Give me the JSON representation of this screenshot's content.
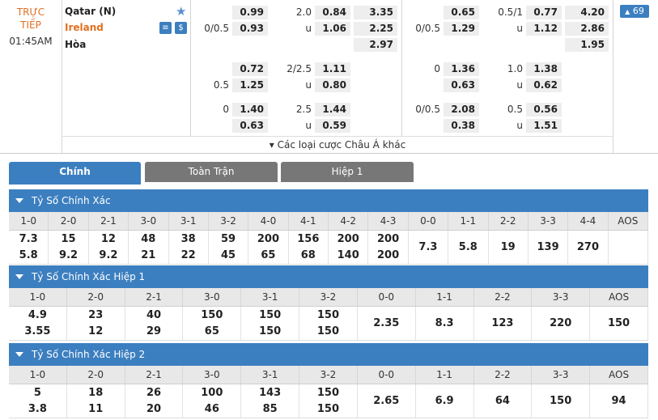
{
  "match": {
    "status": "TRỰC\nTIẾP",
    "status_l1": "TRỰC",
    "status_l2": "TIẾP",
    "time": "01:45AM",
    "home": "Qatar (N)",
    "away": "Ireland",
    "draw": "Hòa",
    "more_count": "69"
  },
  "odds_left": [
    {
      "h": "",
      "ho": "0.99",
      "ou": "2.0",
      "o1": "0.84",
      "x": "3.35"
    },
    {
      "h": "0/0.5",
      "ho": "0.93",
      "ou": "u",
      "o1": "1.06",
      "x": "2.25"
    },
    {
      "h": "",
      "ho": "",
      "ou": "",
      "o1": "",
      "x": "2.97"
    },
    {
      "h": "",
      "ho": "0.72",
      "ou": "2/2.5",
      "o1": "1.11",
      "x": ""
    },
    {
      "h": "0.5",
      "ho": "1.25",
      "ou": "u",
      "o1": "0.80",
      "x": ""
    },
    {
      "h": "0",
      "ho": "1.40",
      "ou": "2.5",
      "o1": "1.44",
      "x": ""
    },
    {
      "h": "",
      "ho": "0.63",
      "ou": "u",
      "o1": "0.59",
      "x": ""
    }
  ],
  "odds_right": [
    {
      "h": "",
      "ho": "0.65",
      "ou": "0.5/1",
      "o1": "0.77",
      "x": "4.20"
    },
    {
      "h": "0/0.5",
      "ho": "1.29",
      "ou": "u",
      "o1": "1.12",
      "x": "2.86"
    },
    {
      "h": "",
      "ho": "",
      "ou": "",
      "o1": "",
      "x": "1.95"
    },
    {
      "h": "0",
      "ho": "1.36",
      "ou": "1.0",
      "o1": "1.38",
      "x": ""
    },
    {
      "h": "",
      "ho": "0.63",
      "ou": "u",
      "o1": "0.62",
      "x": ""
    },
    {
      "h": "0/0.5",
      "ho": "2.08",
      "ou": "0.5",
      "o1": "0.56",
      "x": ""
    },
    {
      "h": "",
      "ho": "0.38",
      "ou": "u",
      "o1": "1.51",
      "x": ""
    }
  ],
  "more_label": "▾ Các loại cược Châu Á khác",
  "tabs": [
    "Chính",
    "Toàn Trận",
    "Hiệp 1"
  ],
  "sections": [
    {
      "title": "Tỷ Số Chính Xác",
      "headers": [
        "1-0",
        "2-0",
        "2-1",
        "3-0",
        "3-1",
        "3-2",
        "4-0",
        "4-1",
        "4-2",
        "4-3",
        "0-0",
        "1-1",
        "2-2",
        "3-3",
        "4-4",
        "AOS"
      ],
      "top": [
        "7.3",
        "15",
        "12",
        "48",
        "38",
        "59",
        "200",
        "156",
        "200",
        "200",
        "7.3",
        "5.8",
        "19",
        "139",
        "270",
        ""
      ],
      "bottom": [
        "5.8",
        "9.2",
        "9.2",
        "21",
        "22",
        "45",
        "65",
        "68",
        "140",
        "200",
        "",
        "",
        "",
        "",
        "",
        ""
      ]
    },
    {
      "title": "Tỷ Số Chính Xác Hiệp 1",
      "headers": [
        "1-0",
        "2-0",
        "2-1",
        "3-0",
        "3-1",
        "3-2",
        "0-0",
        "1-1",
        "2-2",
        "3-3",
        "AOS"
      ],
      "top": [
        "4.9",
        "23",
        "40",
        "150",
        "150",
        "150",
        "2.35",
        "8.3",
        "123",
        "220",
        "150"
      ],
      "bottom": [
        "3.55",
        "12",
        "29",
        "65",
        "150",
        "150",
        "",
        "",
        "",
        "",
        ""
      ]
    },
    {
      "title": "Tỷ Số Chính Xác Hiệp 2",
      "headers": [
        "1-0",
        "2-0",
        "2-1",
        "3-0",
        "3-1",
        "3-2",
        "0-0",
        "1-1",
        "2-2",
        "3-3",
        "AOS"
      ],
      "top": [
        "5",
        "18",
        "26",
        "100",
        "143",
        "150",
        "2.65",
        "6.9",
        "64",
        "150",
        "94"
      ],
      "bottom": [
        "3.8",
        "11",
        "20",
        "46",
        "85",
        "150",
        "",
        "",
        "",
        "",
        ""
      ]
    }
  ],
  "colors": {
    "accent": "#3c7fc0",
    "away_team": "#e07020",
    "status": "#e07020"
  },
  "icons": [
    "favorite-star-icon",
    "stats-icon",
    "money-icon"
  ]
}
